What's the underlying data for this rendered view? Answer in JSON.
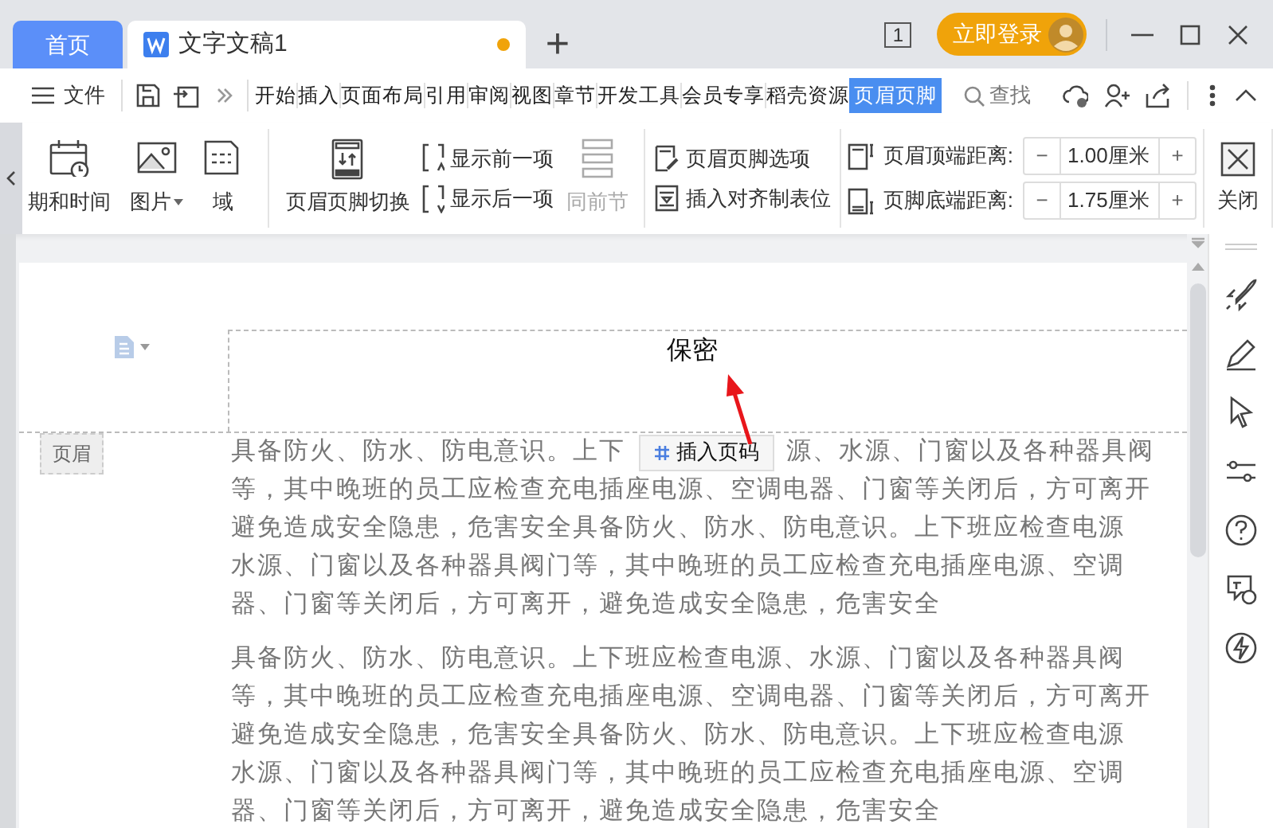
{
  "tabs": [
    {
      "label": "首页",
      "kind": "home",
      "selected": false
    },
    {
      "label": "文字文稿1",
      "kind": "document",
      "selected": true,
      "unsaved": true
    }
  ],
  "new_tab_button": "+",
  "page_count_badge": "1",
  "login_button": "立即登录",
  "file_menu": "文件",
  "menu_tabs": [
    {
      "label": "开始",
      "selected": false
    },
    {
      "label": "插入",
      "selected": false
    },
    {
      "label": "页面布局",
      "selected": false
    },
    {
      "label": "引用",
      "selected": false
    },
    {
      "label": "审阅",
      "selected": false
    },
    {
      "label": "视图",
      "selected": false
    },
    {
      "label": "章节",
      "selected": false
    },
    {
      "label": "开发工具",
      "selected": false
    },
    {
      "label": "会员专享",
      "selected": false
    },
    {
      "label": "稻壳资源",
      "selected": false
    },
    {
      "label": "页眉页脚",
      "selected": true
    }
  ],
  "search": "查找",
  "ribbon": {
    "insert_items": [
      {
        "label": "期和时间",
        "kind": "calendar",
        "dropdown": false
      },
      {
        "label": "图片",
        "kind": "image",
        "dropdown": true
      },
      {
        "label": "域",
        "kind": "field",
        "dropdown": false
      }
    ],
    "switch_button": "页眉页脚切换",
    "nav_items": [
      {
        "label": "显示前一项",
        "kind": "prev"
      },
      {
        "label": "显示后一项",
        "kind": "next"
      }
    ],
    "same_as_previous": {
      "label": "同前节",
      "disabled": true
    },
    "option_items": [
      {
        "label": "页眉页脚选项",
        "kind": "options"
      },
      {
        "label": "插入对齐制表位",
        "kind": "tab"
      }
    ],
    "distances": [
      {
        "label": "页眉顶端距离:",
        "value": "1.00厘米",
        "kind": "top",
        "decrement": "−",
        "increment": "+"
      },
      {
        "label": "页脚底端距离:",
        "value": "1.75厘米",
        "kind": "bottom",
        "decrement": "−",
        "increment": "+"
      }
    ],
    "close_button": "关闭"
  },
  "document": {
    "header_text": "保密",
    "header_label": "页眉",
    "insert_page_number_button": "插入页码",
    "paragraphs": [
      {
        "lines": [
          {
            "parts": [
              "具备防火、防水、防电意识。上下",
              "源、水源、门窗以及各种器具阀"
            ]
          },
          {
            "parts": [
              "等，其中晚班的员工应检查充电插座电源、空调电器、门窗等关闭后，方可离开"
            ]
          },
          {
            "parts": [
              "避免造成安全隐患，危害安全具备防火、防水、防电意识。上下班应检查电源"
            ]
          },
          {
            "parts": [
              "水源、门窗以及各种器具阀门等，其中晚班的员工应检查充电插座电源、空调"
            ]
          },
          {
            "parts": [
              "器、门窗等关闭后，方可离开，避免造成安全隐患，危害安全"
            ]
          }
        ]
      },
      {
        "lines": [
          {
            "parts": [
              "具备防火、防水、防电意识。上下班应检查电源、水源、门窗以及各种器具阀"
            ]
          },
          {
            "parts": [
              "等，其中晚班的员工应检查充电插座电源、空调电器、门窗等关闭后，方可离开"
            ]
          },
          {
            "parts": [
              "避免造成安全隐患，危害安全具备防火、防水、防电意识。上下班应检查电源"
            ]
          },
          {
            "parts": [
              "水源、门窗以及各种器具阀门等，其中晚班的员工应检查充电插座电源、空调"
            ]
          },
          {
            "parts": [
              "器、门窗等关闭后，方可离开，避免造成安全隐患，危害安全"
            ]
          }
        ]
      }
    ]
  }
}
